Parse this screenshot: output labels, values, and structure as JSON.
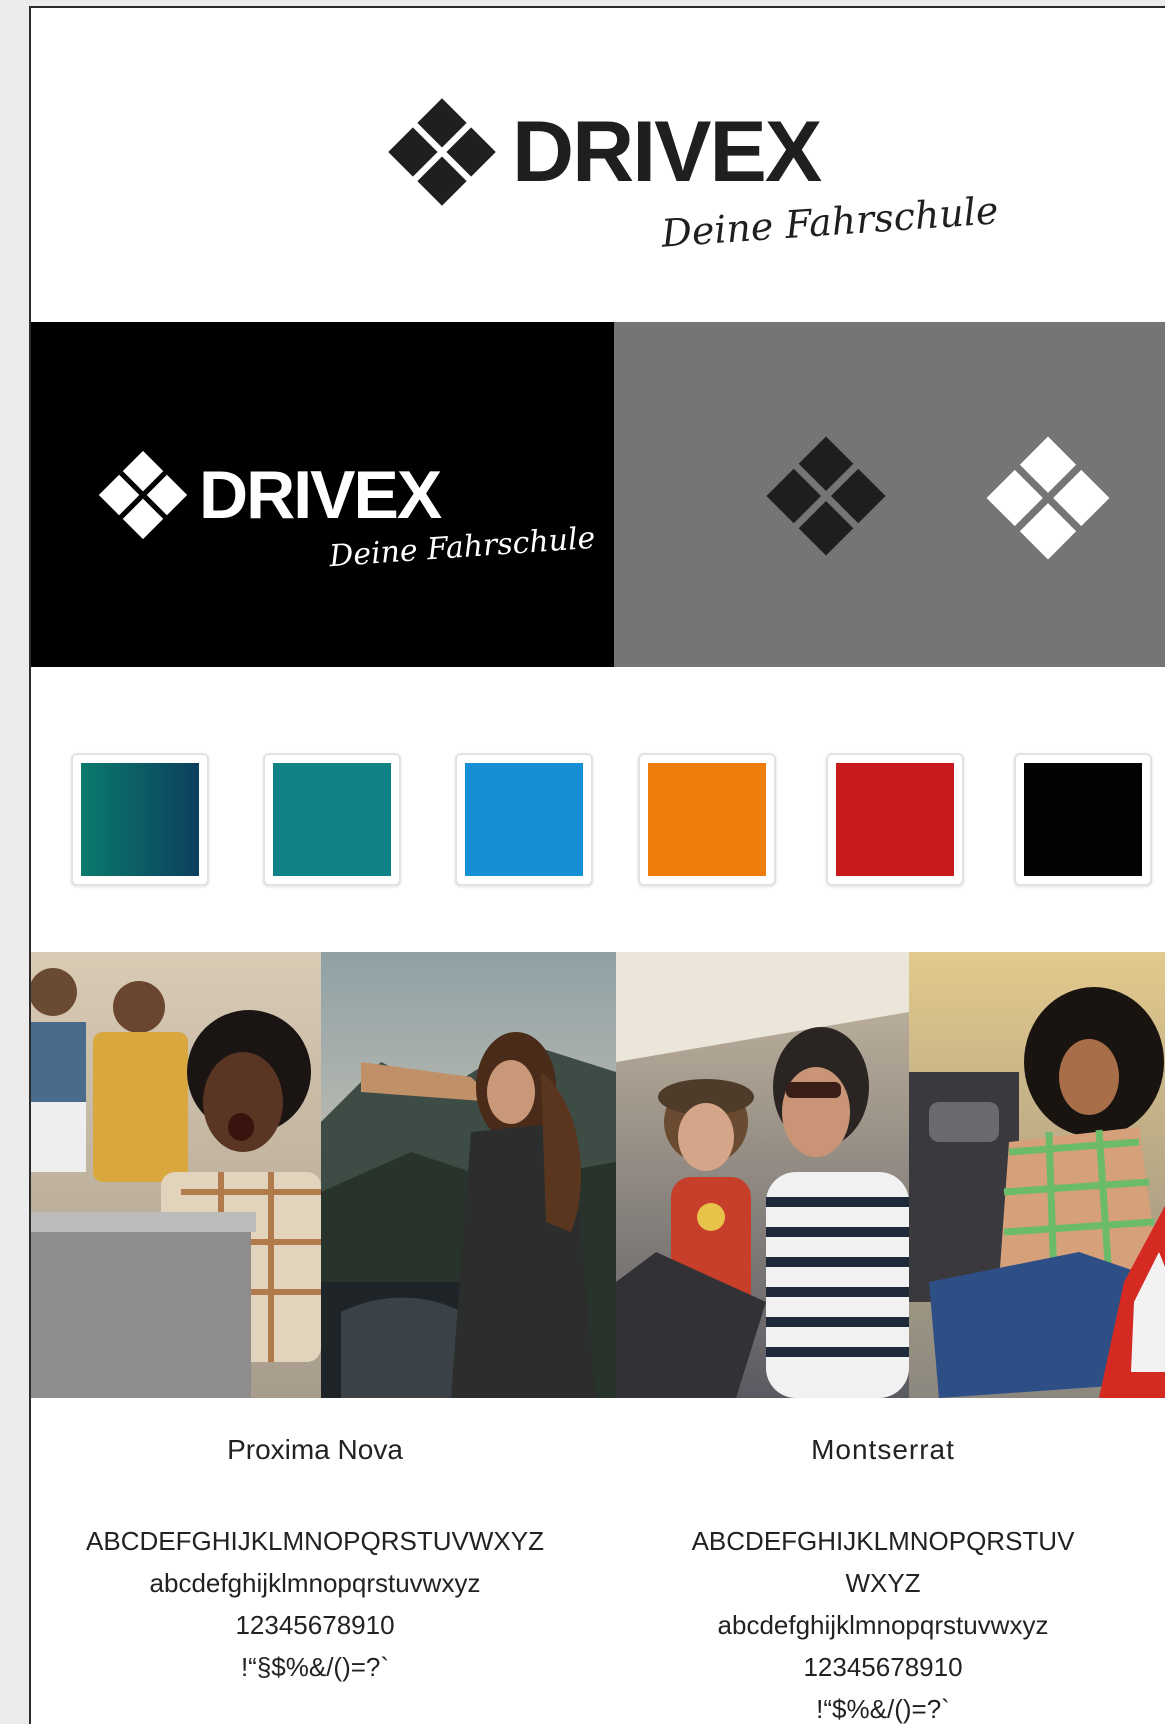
{
  "brand": {
    "name": "DRIVEX",
    "tagline": "Deine Fahrschule"
  },
  "colors": {
    "swatches": [
      {
        "name": "teal-gradient",
        "from": "#0a7a6c",
        "to": "#0c3f5e"
      },
      {
        "name": "teal",
        "hex": "#0f8385"
      },
      {
        "name": "blue",
        "hex": "#168fd5"
      },
      {
        "name": "orange",
        "hex": "#ef7d0b"
      },
      {
        "name": "red",
        "hex": "#c8191c"
      },
      {
        "name": "black",
        "hex": "#030303"
      }
    ],
    "band_dark": "#000000",
    "band_gray": "#757575"
  },
  "typography": {
    "primary": {
      "font_name": "Proxima Nova",
      "lines": [
        "ABCDEFGHIJKLMNOPQRSTUVWXYZ",
        "abcdefghijklmnopqrstuvwxyz",
        "12345678910",
        "!“§$%&/()=?`"
      ]
    },
    "secondary": {
      "font_name": "Montserrat",
      "lines": [
        "ABCDEFGHIJKLMNOPQRSTUV",
        "WXYZ",
        "abcdefghijklmnopqrstuvwxyz",
        "12345678910",
        "!“$%&/()=?`"
      ]
    }
  },
  "photos": [
    {
      "name": "friends-laptop-photo"
    },
    {
      "name": "mountain-car-photo"
    },
    {
      "name": "car-friends-photo"
    },
    {
      "name": "roadside-phone-photo"
    }
  ]
}
